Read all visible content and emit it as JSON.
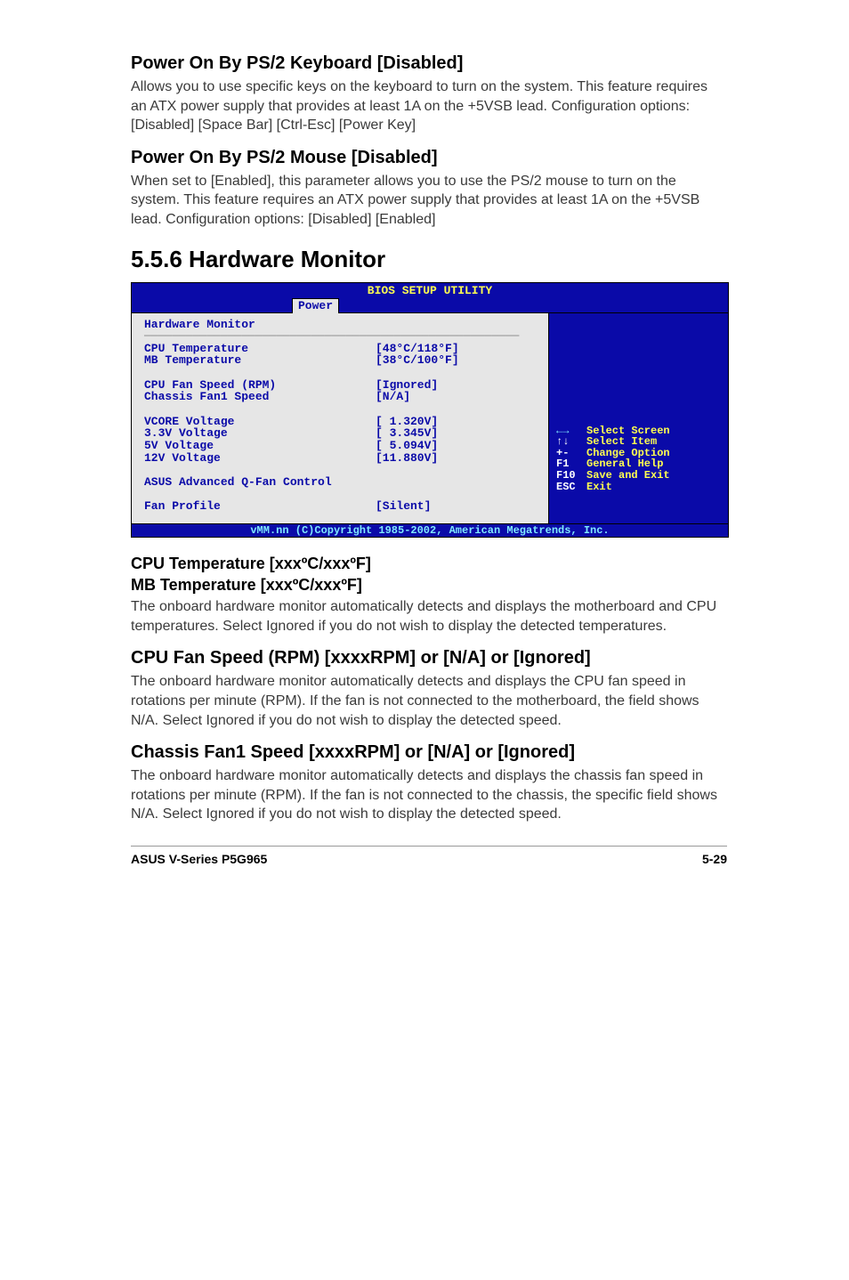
{
  "section1": {
    "title": "Power On By PS/2 Keyboard [Disabled]",
    "body": "Allows you to use specific keys on the keyboard to turn on the system. This feature requires an ATX power supply that provides at least 1A on the +5VSB lead. Configuration options: [Disabled] [Space Bar] [Ctrl-Esc] [Power Key]"
  },
  "section2": {
    "title": "Power On By PS/2 Mouse [Disabled]",
    "body": "When set to [Enabled], this parameter allows you to use the PS/2 mouse to turn on the system. This feature requires an ATX power supply that provides at least 1A on the +5VSB lead. Configuration options: [Disabled] [Enabled]"
  },
  "hwmon_heading": "5.5.6   Hardware Monitor",
  "bios": {
    "title": "BIOS SETUP UTILITY",
    "tab": "Power",
    "header": "Hardware Monitor",
    "rows": [
      {
        "label": "CPU Temperature",
        "value": "[48°C/118°F]"
      },
      {
        "label": "MB Temperature",
        "value": "[38°C/100°F]"
      },
      {
        "label": "",
        "value": ""
      },
      {
        "label": "CPU Fan Speed (RPM)",
        "value": "[Ignored]"
      },
      {
        "label": "Chassis Fan1 Speed",
        "value": "[N/A]"
      },
      {
        "label": "",
        "value": ""
      },
      {
        "label": "VCORE Voltage",
        "value": "[ 1.320V]"
      },
      {
        "label": "3.3V Voltage",
        "value": "[ 3.345V]"
      },
      {
        "label": "5V Voltage",
        "value": "[ 5.094V]"
      },
      {
        "label": "12V Voltage",
        "value": "[11.880V]"
      },
      {
        "label": "",
        "value": ""
      },
      {
        "label": "ASUS Advanced Q-Fan Control",
        "value": ""
      },
      {
        "label": "",
        "value": ""
      },
      {
        "label": "Fan Profile",
        "value": "[Silent]"
      }
    ],
    "help": [
      {
        "key": "←→",
        "label": "Select Screen"
      },
      {
        "key": "↑↓",
        "label": "Select Item"
      },
      {
        "key": "+-",
        "label": "Change Option"
      },
      {
        "key": "F1",
        "label": "General Help"
      },
      {
        "key": "F10",
        "label": "Save and Exit"
      },
      {
        "key": "ESC",
        "label": "Exit"
      }
    ],
    "copyright": "vMM.nn (C)Copyright 1985-2002, American Megatrends, Inc."
  },
  "section3": {
    "title_line1": "CPU Temperature [xxxºC/xxxºF]",
    "title_line2": "MB Temperature [xxxºC/xxxºF]",
    "body": "The onboard hardware monitor automatically detects and displays the motherboard and CPU temperatures. Select Ignored if you do not wish to display the detected temperatures."
  },
  "section4": {
    "title": "CPU Fan Speed (RPM) [xxxxRPM] or [N/A] or [Ignored]",
    "body": "The onboard hardware monitor automatically detects and displays the CPU fan speed in rotations per minute (RPM). If the fan is not connected to the motherboard, the field shows N/A. Select Ignored if you do not wish to display the detected speed."
  },
  "section5": {
    "title": "Chassis Fan1 Speed [xxxxRPM] or [N/A] or [Ignored]",
    "body": "The onboard hardware monitor automatically detects and displays the chassis fan speed in rotations per minute (RPM). If the fan is not connected to the chassis, the specific field shows N/A. Select Ignored if you do not wish to display the detected speed."
  },
  "footer": {
    "left": "ASUS V-Series P5G965",
    "right": "5-29"
  }
}
